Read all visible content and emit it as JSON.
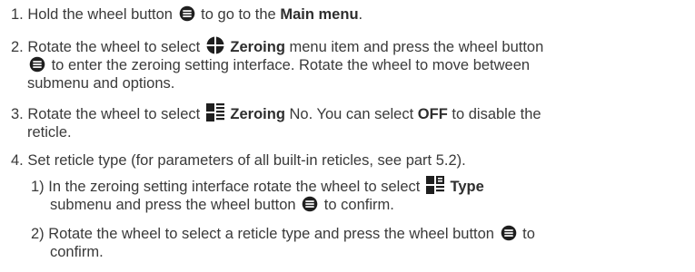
{
  "steps": [
    {
      "num": "1.",
      "t1": "Hold the wheel button",
      "t2": "to go to the",
      "bold1": "Main menu",
      "t3": "."
    },
    {
      "num": "2.",
      "t1": "Rotate the wheel to select",
      "bold1": "Zeroing",
      "t2": "menu item and press the wheel button",
      "t3": "to enter the zeroing setting interface. Rotate the wheel to move between",
      "t4": "submenu and options."
    },
    {
      "num": "3.",
      "t1": "Rotate the wheel to select",
      "bold1": "Zeroing",
      "t2": "No. You can select",
      "bold2": "OFF",
      "t3": "to disable the",
      "t4": "reticle."
    },
    {
      "num": "4.",
      "t1": "Set reticle type (for parameters of all built-in reticles, see part 5.2)."
    }
  ],
  "substeps": [
    {
      "num": "1)",
      "t1": "In the zeroing setting interface rotate the wheel to select",
      "bold1": "Type",
      "t2": "submenu and press the wheel button",
      "t3": "to confirm."
    },
    {
      "num": "2)",
      "t1": "Rotate the wheel to select a reticle type and press the wheel button",
      "t2": "to",
      "t3": "confirm."
    }
  ],
  "icons": {
    "wheel_button": "wheel-button-icon",
    "zeroing_menu": "crosshair-menu-icon",
    "zeroing_no": "zeroing-number-icon",
    "reticle_type": "reticle-type-icon"
  },
  "colors": {
    "text": "#3a3a3a",
    "icon": "#1f1f1f"
  }
}
